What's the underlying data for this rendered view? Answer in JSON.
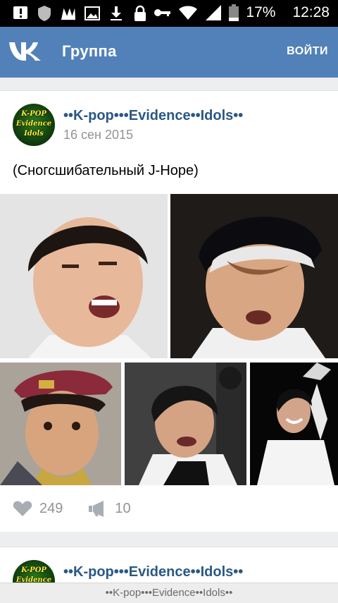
{
  "status_bar": {
    "battery": "17%",
    "time": "12:28",
    "icons": [
      "alert-icon",
      "shield-icon",
      "m-app-icon",
      "image-icon",
      "download-icon",
      "lock-icon",
      "key-icon",
      "wifi-icon",
      "signal-icon",
      "battery-icon"
    ]
  },
  "app_bar": {
    "logo": "vk-logo",
    "title": "Группа",
    "login_label": "ВОЙТИ",
    "color": "#5181b8"
  },
  "posts": [
    {
      "author": "••K-pop•••Evidence••Idols••",
      "avatar_text": "K-POP Evidence Idols",
      "date": "16 сен 2015",
      "text": "(Сногсшибательный J-Hope)",
      "photo_count": 5,
      "likes": "249",
      "reposts": "10"
    },
    {
      "author": "••K-pop•••Evidence••Idols••",
      "avatar_text": "K-POP Evidence Idols"
    }
  ],
  "bottom_bar": {
    "title": "••K-pop•••Evidence••Idols••"
  }
}
